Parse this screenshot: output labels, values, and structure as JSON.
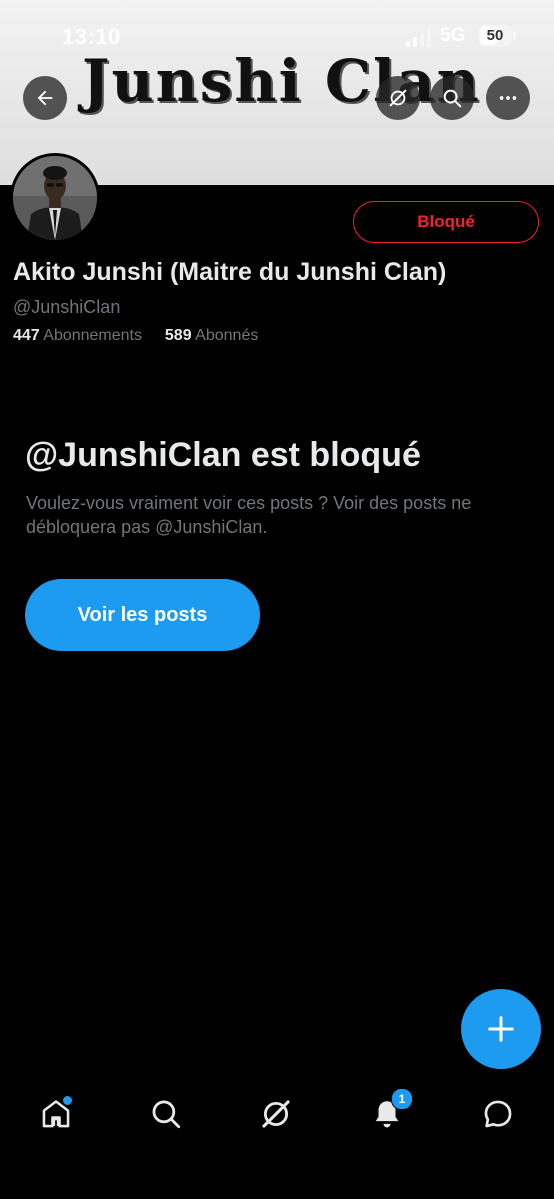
{
  "status_bar": {
    "time": "13:10",
    "network": "5G",
    "battery": "50"
  },
  "banner": {
    "title": "Junshi Clan"
  },
  "header": {
    "back_icon": "arrow-left-icon",
    "grok_icon": "grok-icon",
    "search_icon": "search-icon",
    "more_icon": "more-horizontal-icon"
  },
  "profile": {
    "display_name": "Akito Junshi (Maitre du Junshi Clan)",
    "handle": "@JunshiClan",
    "following_count": "447",
    "following_label": "Abonnements",
    "followers_count": "589",
    "followers_label": "Abonnés",
    "blocked_button_label": "Bloqué"
  },
  "blocked_notice": {
    "title": "@JunshiClan est bloqué",
    "description": "Voulez-vous vraiment voir ces posts ? Voir des posts ne débloquera pas @JunshiClan.",
    "view_posts_label": "Voir les posts"
  },
  "tabbar": {
    "items": [
      {
        "name": "home",
        "icon": "home-icon"
      },
      {
        "name": "search",
        "icon": "search-icon"
      },
      {
        "name": "grok",
        "icon": "grok-icon"
      },
      {
        "name": "notifications",
        "icon": "bell-icon",
        "badge": "1"
      },
      {
        "name": "messages",
        "icon": "message-icon"
      }
    ]
  },
  "colors": {
    "accent": "#1d9bf0",
    "blocked_red": "#f4212e",
    "background": "#000000",
    "secondary_text": "#71767b"
  }
}
